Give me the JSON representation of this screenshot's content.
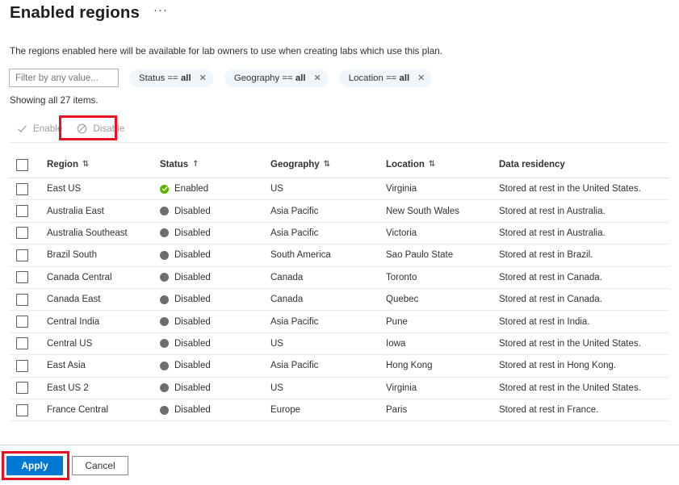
{
  "header": {
    "title": "Enabled regions",
    "more_menu": "···",
    "more_menu_icon": "ellipsis-icon"
  },
  "description": "The regions enabled here will be available for lab owners to use when creating labs which use this plan.",
  "filter_bar": {
    "input_placeholder": "Filter by any value...",
    "input_value": "",
    "chips": [
      {
        "field": "Status",
        "op": "==",
        "value": "all",
        "close_icon": "✕"
      },
      {
        "field": "Geography",
        "op": "==",
        "value": "all",
        "close_icon": "✕"
      },
      {
        "field": "Location",
        "op": "==",
        "value": "all",
        "close_icon": "✕"
      }
    ]
  },
  "showing_text": "Showing all 27 items.",
  "toolbar": {
    "enable_label": "Enable",
    "enable_icon": "checkmark-icon",
    "disable_label": "Disable",
    "disable_icon": "block-icon",
    "enable_disabled": true,
    "disable_disabled": true
  },
  "table": {
    "select_all_checked": false,
    "columns": [
      {
        "key": "region",
        "label": "Region",
        "sort": "⇅"
      },
      {
        "key": "status",
        "label": "Status",
        "sort": "↑"
      },
      {
        "key": "geo",
        "label": "Geography",
        "sort": "⇅"
      },
      {
        "key": "loc",
        "label": "Location",
        "sort": "⇅"
      },
      {
        "key": "data",
        "label": "Data residency",
        "sort": ""
      }
    ],
    "rows": [
      {
        "region": "East US",
        "status": "Enabled",
        "geo": "US",
        "loc": "Virginia",
        "data": "Stored at rest in the United States.",
        "checked": false
      },
      {
        "region": "Australia East",
        "status": "Disabled",
        "geo": "Asia Pacific",
        "loc": "New South Wales",
        "data": "Stored at rest in Australia.",
        "checked": false
      },
      {
        "region": "Australia Southeast",
        "status": "Disabled",
        "geo": "Asia Pacific",
        "loc": "Victoria",
        "data": "Stored at rest in Australia.",
        "checked": false
      },
      {
        "region": "Brazil South",
        "status": "Disabled",
        "geo": "South America",
        "loc": "Sao Paulo State",
        "data": "Stored at rest in Brazil.",
        "checked": false
      },
      {
        "region": "Canada Central",
        "status": "Disabled",
        "geo": "Canada",
        "loc": "Toronto",
        "data": "Stored at rest in Canada.",
        "checked": false
      },
      {
        "region": "Canada East",
        "status": "Disabled",
        "geo": "Canada",
        "loc": "Quebec",
        "data": "Stored at rest in Canada.",
        "checked": false
      },
      {
        "region": "Central India",
        "status": "Disabled",
        "geo": "Asia Pacific",
        "loc": "Pune",
        "data": "Stored at rest in India.",
        "checked": false
      },
      {
        "region": "Central US",
        "status": "Disabled",
        "geo": "US",
        "loc": "Iowa",
        "data": "Stored at rest in the United States.",
        "checked": false
      },
      {
        "region": "East Asia",
        "status": "Disabled",
        "geo": "Asia Pacific",
        "loc": "Hong Kong",
        "data": "Stored at rest in Hong Kong.",
        "checked": false
      },
      {
        "region": "East US 2",
        "status": "Disabled",
        "geo": "US",
        "loc": "Virginia",
        "data": "Stored at rest in the United States.",
        "checked": false
      },
      {
        "region": "France Central",
        "status": "Disabled",
        "geo": "Europe",
        "loc": "Paris",
        "data": "Stored at rest in France.",
        "checked": false
      }
    ]
  },
  "footer": {
    "apply_label": "Apply",
    "cancel_label": "Cancel"
  },
  "annotations": {
    "highlight_color": "#e81123",
    "highlighted_elements": [
      "Disable",
      "Apply"
    ]
  },
  "colors": {
    "primary": "#0078d4",
    "enabled_status": "#5cb300",
    "disabled_status": "#6e6e6e",
    "chip_background": "#eff6fc",
    "highlight": "#e81123"
  }
}
